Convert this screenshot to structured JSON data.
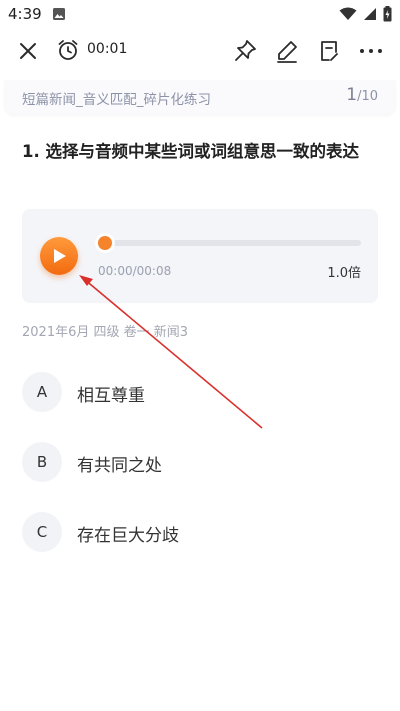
{
  "status_bar": {
    "time": "4:39"
  },
  "toolbar": {
    "elapsed": "00:01"
  },
  "header": {
    "title": "短篇新闻_音义匹配_碎片化练习",
    "current": "1",
    "total": "/10"
  },
  "question": {
    "text": "1. 选择与音频中某些词或词组意思一致的表达"
  },
  "audio": {
    "time_display": "00:00/00:08",
    "speed": "1.0倍",
    "progress": 0.0
  },
  "source": {
    "text": "2021年6月 四级 卷一 新闻3"
  },
  "options": [
    {
      "letter": "A",
      "text": "相互尊重"
    },
    {
      "letter": "B",
      "text": "有共同之处"
    },
    {
      "letter": "C",
      "text": "存在巨大分歧"
    }
  ],
  "colors": {
    "accent": "#f5842c",
    "annotation": "#d9302c",
    "muted": "#8c93a8"
  }
}
